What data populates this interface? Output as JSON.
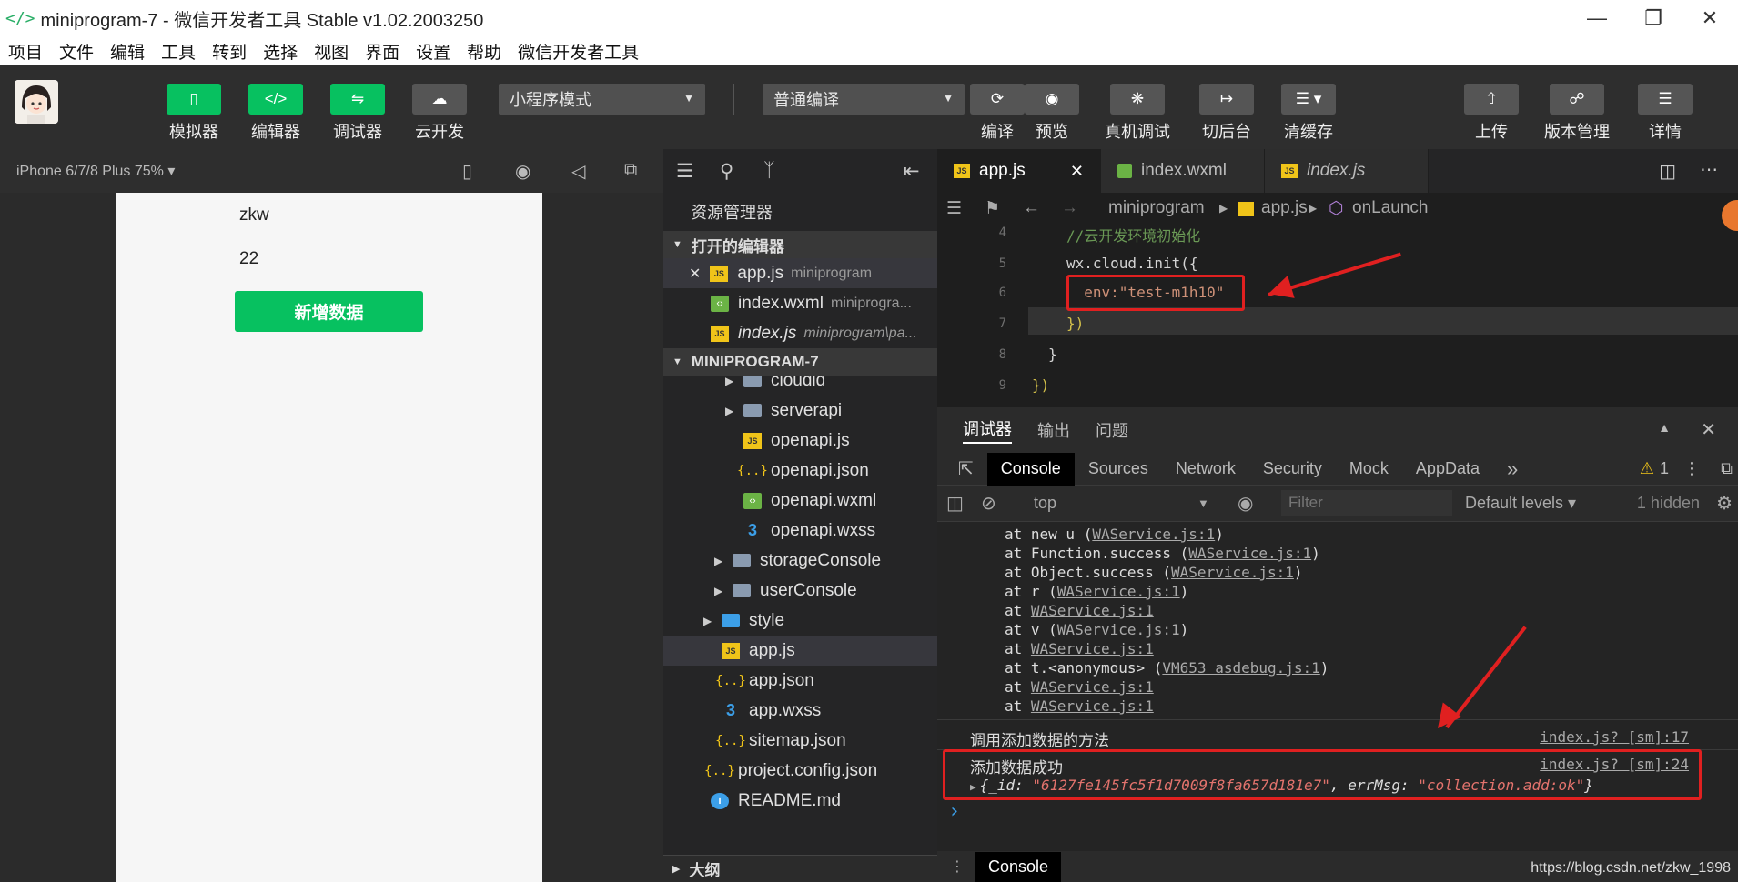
{
  "window": {
    "title": "miniprogram-7 - 微信开发者工具 Stable v1.02.2003250"
  },
  "menu": [
    "项目",
    "文件",
    "编辑",
    "工具",
    "转到",
    "选择",
    "视图",
    "界面",
    "设置",
    "帮助",
    "微信开发者工具"
  ],
  "toolbar": {
    "simulator": "模拟器",
    "editor": "编辑器",
    "debugger": "调试器",
    "cloud": "云开发",
    "mode": "小程序模式",
    "compile_mode": "普通编译",
    "compile": "编译",
    "preview": "预览",
    "real_debug": "真机调试",
    "background": "切后台",
    "clear_cache": "清缓存",
    "upload": "上传",
    "version": "版本管理",
    "details": "详情"
  },
  "device": {
    "name": "iPhone 6/7/8 Plus 75% ▾"
  },
  "phone": {
    "text1": "zkw",
    "text2": "22",
    "button": "新增数据"
  },
  "explorer": {
    "title": "资源管理器",
    "open_editors": "打开的编辑器",
    "open_files": [
      {
        "name": "app.js",
        "sub": "miniprogram"
      },
      {
        "name": "index.wxml",
        "sub": "miniprogra..."
      },
      {
        "name": "index.js",
        "sub": "miniprogram\\pa..."
      }
    ],
    "project": "MINIPROGRAM-7",
    "tree": [
      {
        "name": "cloudid"
      },
      {
        "name": "serverapi"
      },
      {
        "name": "openapi.js"
      },
      {
        "name": "openapi.json"
      },
      {
        "name": "openapi.wxml"
      },
      {
        "name": "openapi.wxss"
      },
      {
        "name": "storageConsole"
      },
      {
        "name": "userConsole"
      },
      {
        "name": "style"
      },
      {
        "name": "app.js"
      },
      {
        "name": "app.json"
      },
      {
        "name": "app.wxss"
      },
      {
        "name": "sitemap.json"
      },
      {
        "name": "project.config.json"
      },
      {
        "name": "README.md"
      }
    ],
    "outline": "大纲"
  },
  "editor": {
    "tabs": [
      "app.js",
      "index.wxml",
      "index.js"
    ],
    "breadcrumb": {
      "folder": "miniprogram",
      "file": "app.js",
      "symbol": "onLaunch"
    },
    "lines": [
      {
        "num": "4",
        "text": "//云开发环境初始化"
      },
      {
        "num": "5",
        "text": "wx.cloud.init({"
      },
      {
        "num": "6",
        "text": "  env:\"test-m1h10\""
      },
      {
        "num": "7",
        "text": "})"
      },
      {
        "num": "8",
        "text": "}"
      },
      {
        "num": "9",
        "text": "})"
      }
    ]
  },
  "debug": {
    "tabs": [
      "调试器",
      "输出",
      "问题"
    ],
    "console_tabs": [
      "Console",
      "Sources",
      "Network",
      "Security",
      "Mock",
      "AppData"
    ],
    "more": "»",
    "warnings": "1",
    "context": "top",
    "filter_placeholder": "Filter",
    "levels": "Default levels ▾",
    "hidden": "1 hidden",
    "stack": [
      {
        "pre": "at new u (",
        "link": "WAService.js:1",
        "post": ")"
      },
      {
        "pre": "at Function.success (",
        "link": "WAService.js:1",
        "post": ")"
      },
      {
        "pre": "at Object.success (",
        "link": "WAService.js:1",
        "post": ")"
      },
      {
        "pre": "at r (",
        "link": "WAService.js:1",
        "post": ")"
      },
      {
        "pre": "at ",
        "link": "WAService.js:1",
        "post": ""
      },
      {
        "pre": "at v (",
        "link": "WAService.js:1",
        "post": ")"
      },
      {
        "pre": "at ",
        "link": "WAService.js:1",
        "post": ""
      },
      {
        "pre": "at t.<anonymous> (",
        "link": "VM653 asdebug.js:1",
        "post": ")"
      },
      {
        "pre": "at ",
        "link": "WAService.js:1",
        "post": ""
      },
      {
        "pre": "at ",
        "link": "WAService.js:1",
        "post": ""
      }
    ],
    "msg1": "调用添加数据的方法",
    "msg1_src": "index.js? [sm]:17",
    "msg2": "添加数据成功",
    "msg2_src": "index.js? [sm]:24",
    "obj_open": "{_id: ",
    "obj_id": "\"6127fe145fc5f1d7009f8fa657d181e7\"",
    "obj_mid": ", errMsg: ",
    "obj_err": "\"collection.add:ok\"",
    "obj_close": "}",
    "prompt": "›",
    "bottom_tab": "Console"
  },
  "watermark": "https://blog.csdn.net/zkw_1998",
  "colors": {
    "accent": "#07c160",
    "annotation": "#e02020"
  }
}
